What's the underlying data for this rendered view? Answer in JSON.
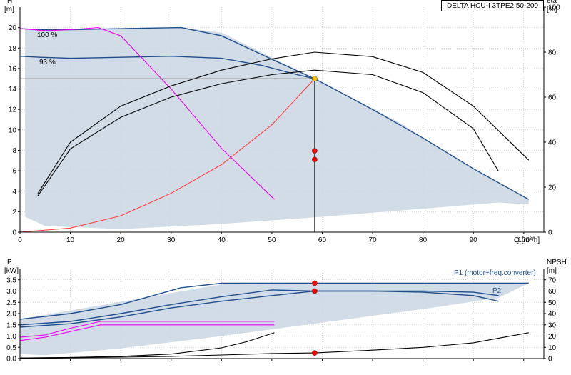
{
  "chart_data": [
    {
      "type": "line",
      "title": "DELTA HCU-I 3TPE2 50-200",
      "xlabel": "Q [m³/h]",
      "ylabel_left": {
        "symbol": "H",
        "unit": "[m]"
      },
      "ylabel_right": {
        "symbol": "eta",
        "unit": "[%]"
      },
      "xlim": [
        0,
        104
      ],
      "ylim_left": [
        0,
        22
      ],
      "ylim_right": [
        0,
        100
      ],
      "x_ticks": [
        "0",
        "10",
        "20",
        "30",
        "40",
        "50",
        "60",
        "70",
        "80",
        "90",
        "100"
      ],
      "y_ticks_left": [
        "0",
        "2",
        "4",
        "6",
        "8",
        "10",
        "12",
        "14",
        "16",
        "18",
        "20"
      ],
      "y_ticks_right": [
        "0",
        "20",
        "40",
        "60",
        "80",
        "100"
      ],
      "grid": true,
      "curve_labels": [
        "100 %",
        "93 %"
      ],
      "series": [
        {
          "role": "envelope",
          "color": "#c9d6e3",
          "x": [
            0,
            1,
            4,
            8,
            32,
            40,
            58.5,
            75,
            88,
            101,
            101,
            95,
            80,
            60,
            40,
            20,
            5,
            1,
            1
          ],
          "y": [
            19.9,
            19.9,
            19.8,
            19.8,
            20.0,
            19.5,
            15.0,
            10.8,
            6.8,
            3.2,
            2.7,
            2.9,
            2.3,
            1.5,
            0.8,
            0.3,
            0.6,
            1.5,
            19.9
          ]
        },
        {
          "role": "H 100%",
          "color": "#1f4e8c",
          "x": [
            0,
            4,
            10,
            20,
            32,
            40,
            50,
            58.5,
            70,
            80,
            90,
            101
          ],
          "y": [
            19.9,
            19.8,
            19.8,
            19.9,
            20.0,
            19.2,
            16.9,
            15.0,
            12.0,
            9.2,
            6.2,
            3.2
          ]
        },
        {
          "role": "H 93%",
          "color": "#1f4e8c",
          "x": [
            0,
            4,
            10,
            20,
            30,
            40,
            48,
            55,
            58.5
          ],
          "y": [
            17.2,
            17.1,
            17.0,
            17.1,
            17.2,
            17.0,
            16.3,
            15.4,
            15.0
          ]
        },
        {
          "role": "system curve",
          "color": "#ff4040",
          "x": [
            0,
            10,
            20,
            30,
            40,
            50,
            58.5
          ],
          "y": [
            0,
            0.4,
            1.6,
            3.8,
            6.6,
            10.5,
            15.0
          ]
        },
        {
          "role": "H max curve",
          "color": "#ee00ee",
          "x": [
            0,
            5,
            10,
            15.5,
            20,
            30,
            40,
            50.5
          ],
          "y": [
            19.9,
            19.7,
            19.8,
            20.0,
            19.2,
            14.0,
            8.2,
            3.2
          ]
        },
        {
          "role": "eta 100% (scale %)",
          "color": "#000000",
          "x": [
            3.5,
            10,
            20,
            30,
            40,
            50,
            58.5,
            70,
            80,
            90,
            95
          ],
          "y": [
            16,
            37,
            51,
            60,
            66,
            70,
            72,
            70,
            62,
            46,
            27
          ]
        },
        {
          "role": "eta 93% (scale %)",
          "color": "#000000",
          "x": [
            3.5,
            10,
            20,
            30,
            40,
            50,
            58.5,
            70,
            80,
            90,
            101
          ],
          "y": [
            17,
            40,
            56,
            65,
            72,
            77,
            80,
            78,
            71,
            56,
            32
          ]
        }
      ],
      "points": [
        {
          "x": 58.5,
          "y": 15.0,
          "color": "#ffc000"
        },
        {
          "x": 58.5,
          "y": 7.95,
          "color": "#ff0000"
        },
        {
          "x": 58.5,
          "y": 7.1,
          "color": "#ff0000"
        }
      ],
      "hline_y": 15.0,
      "vline_x": 58.5
    },
    {
      "type": "line",
      "ylabel_left": {
        "symbol": "P",
        "unit": "[kW]"
      },
      "ylabel_right": {
        "symbol": "NPSH",
        "unit": "[m]"
      },
      "xlim": [
        0,
        104
      ],
      "ylim_left": [
        0,
        4.0
      ],
      "ylim_right": [
        0,
        80
      ],
      "y_ticks_left": [
        "0.0",
        "0.5",
        "1.0",
        "1.5",
        "2.0",
        "2.5",
        "3.0",
        "3.5"
      ],
      "y_ticks_right": [
        "0",
        "10",
        "20",
        "30",
        "40",
        "50",
        "60",
        "70"
      ],
      "grid": true,
      "series_labels": [
        "P1 (motor+freq.converter)",
        "P2"
      ],
      "series": [
        {
          "role": "envelope",
          "color": "#c9d6e3",
          "x": [
            0,
            40,
            58,
            80,
            101,
            95,
            80,
            60,
            40,
            20,
            5,
            0
          ],
          "y": [
            1.75,
            3.3,
            3.35,
            3.35,
            3.35,
            2.7,
            2.2,
            1.6,
            1.0,
            0.45,
            0.15,
            0.2
          ]
        },
        {
          "role": "P1 100%",
          "color": "#1f4e8c",
          "x": [
            0,
            10,
            20,
            30,
            40,
            50,
            58.5,
            70,
            80,
            90,
            95
          ],
          "y": [
            1.5,
            1.65,
            2.0,
            2.4,
            2.75,
            3.05,
            3.0,
            3.0,
            3.0,
            2.95,
            2.8
          ]
        },
        {
          "role": "P1 max",
          "color": "#1f4e8c",
          "x": [
            0,
            10,
            20,
            32,
            40,
            50,
            58.5,
            70,
            80,
            90,
            101
          ],
          "y": [
            1.75,
            2.0,
            2.4,
            3.15,
            3.35,
            3.35,
            3.35,
            3.35,
            3.35,
            3.35,
            3.35
          ]
        },
        {
          "role": "P2",
          "color": "#1f4e8c",
          "x": [
            0,
            10,
            20,
            30,
            40,
            50,
            58.5,
            70,
            80,
            90,
            95
          ],
          "y": [
            1.4,
            1.55,
            1.85,
            2.25,
            2.55,
            2.8,
            3.0,
            3.0,
            2.95,
            2.8,
            2.55
          ]
        },
        {
          "role": "P max curve",
          "color": "#ee00ee",
          "x": [
            0,
            5,
            10,
            16,
            20,
            30,
            40,
            50.5
          ],
          "y": [
            0.95,
            1.05,
            1.35,
            1.65,
            1.65,
            1.65,
            1.65,
            1.65
          ]
        },
        {
          "role": "P 93% magenta",
          "color": "#ee00ee",
          "x": [
            0,
            5,
            10,
            16,
            20,
            30,
            40,
            50.5
          ],
          "y": [
            0.8,
            0.95,
            1.2,
            1.5,
            1.5,
            1.5,
            1.5,
            1.5
          ]
        },
        {
          "role": "NPSH 100% (scale m)",
          "color": "#000000",
          "x": [
            0,
            10,
            20,
            30,
            40,
            50,
            58.5,
            70,
            80,
            90,
            101
          ],
          "y": [
            0.5,
            0.8,
            1.3,
            2.0,
            3.2,
            4.5,
            5.0,
            7.5,
            10.0,
            14.0,
            23.0
          ]
        },
        {
          "role": "NPSH max curve (scale m)",
          "color": "#000000",
          "x": [
            0,
            10,
            20,
            30,
            40,
            45,
            50.5
          ],
          "y": [
            0.5,
            1.0,
            2.0,
            4.0,
            9.5,
            15.0,
            23.0
          ]
        }
      ],
      "points": [
        {
          "x": 58.5,
          "y": 3.35,
          "color": "#ff0000"
        },
        {
          "x": 58.5,
          "y": 3.0,
          "color": "#ff0000"
        },
        {
          "x": 58.5,
          "y": 0.25,
          "color": "#ff0000"
        }
      ]
    }
  ],
  "colors": {
    "envelope": "#c9d6e3",
    "curve": "#1f4e8c",
    "magenta": "#ee00ee",
    "operating": "#ff0000",
    "duty": "#ffc000",
    "system": "#ff4040",
    "axis": "#000000"
  }
}
